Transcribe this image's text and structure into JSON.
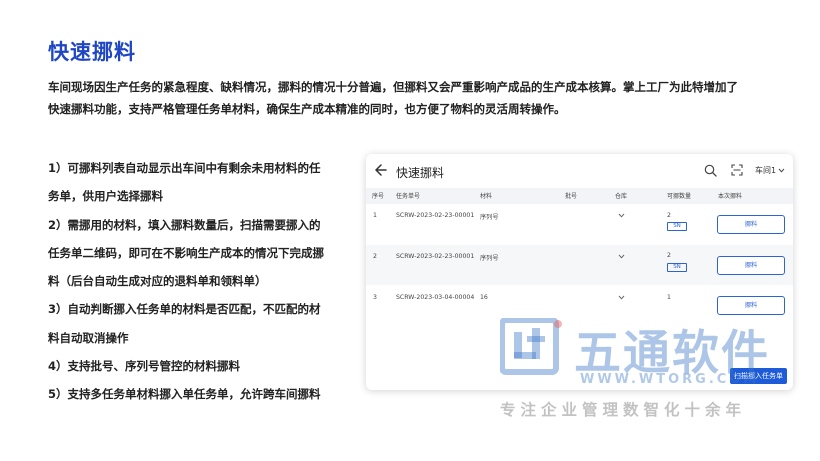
{
  "page": {
    "title": "快速挪料",
    "intro_line1": "车间现场因生产任务的紧急程度、缺料情况，挪料的情况十分普遍，但挪料又会严重影响产成品的生产成本核算。掌上工厂为此特增加了",
    "intro_line2": "快速挪料功能，支持严格管理任务单材料，确保生产成本精准的同时，也方便了物料的灵活周转操作。",
    "features": [
      "1）可挪料列表自动显示出车间中有剩余未用材料的任",
      "务单，供用户选择挪料",
      "2）需挪用的材料，填入挪料数量后，扫描需要挪入的",
      "任务单二维码，即可在不影响生产成本的情况下完成挪",
      "料（后台自动生成对应的退料单和领料单）",
      "3）自动判断挪入任务单的材料是否匹配，不匹配的材",
      "料自动取消操作",
      "4）支持批号、序列号管控的材料挪料",
      "5）支持多任务单材料挪入单任务单，允许跨车间挪料"
    ]
  },
  "app": {
    "title": "快速挪料",
    "workshop": "车间1",
    "icons": {
      "back": "back-arrow-icon",
      "search": "search-icon",
      "scan": "scan-icon",
      "dropdown": "chevron-down-icon"
    },
    "columns": [
      "序号",
      "任务单号",
      "材料",
      "批号",
      "仓库",
      "可挪数量",
      "本次挪料"
    ],
    "rows": [
      {
        "no": "1",
        "task": "SCRW-2023-02-23-00001",
        "material": "序列号",
        "qty": "2",
        "tag": "SN",
        "action": "挪料"
      },
      {
        "no": "2",
        "task": "SCRW-2023-02-23-00001",
        "material": "序列号",
        "qty": "2",
        "tag": "SN",
        "action": "挪料"
      },
      {
        "no": "3",
        "task": "SCRW-2023-03-04-00004",
        "material": "16",
        "qty": "1",
        "tag": "",
        "action": "挪料"
      }
    ],
    "submit": "扫描挪入任务单"
  },
  "watermark": {
    "logo_text": "ut",
    "name": "五通软件",
    "url": "WWW.WTORG.COM",
    "slogan": "专注企业管理数智化十余年"
  },
  "colors": {
    "brand": "#1f47c4",
    "accent": "#1e5bd9"
  }
}
